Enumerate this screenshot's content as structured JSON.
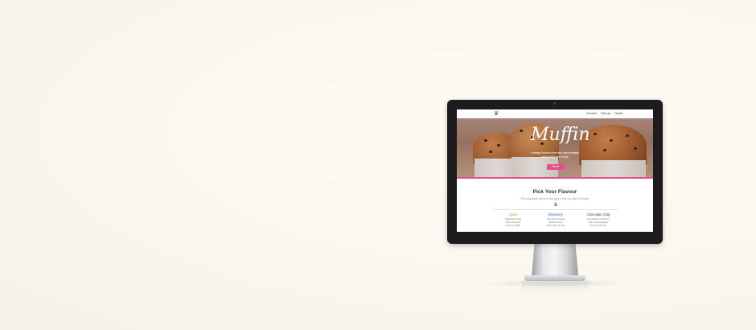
{
  "site": {
    "nav": {
      "links": [
        "Overview",
        "Flavours",
        "Details"
      ]
    },
    "hero": {
      "title": "Muffin",
      "subtitle_line1": "A design focused free and web template",
      "subtitle_line2": "using SASS and Jekyll",
      "button_label": "Demo"
    },
    "section": {
      "title": "Pick Your Flavour",
      "subtitle": "Pick a package based on the type of site you want to design."
    },
    "flavours": [
      {
        "name": "Apple",
        "color": "#8dc63f",
        "lines": [
          "Faded Encoding",
          "Pure discovery",
          "Limit the DMS"
        ]
      },
      {
        "name": "Blueberry",
        "color": "#2b6cb0",
        "lines": [
          "Something Unique",
          "Skill the story",
          "Self Image of web"
        ]
      },
      {
        "name": "Chocolate Chip",
        "color": "#444444",
        "lines": [
          "Something to Enhance",
          "Well contemplating",
          "The introduction"
        ]
      }
    ]
  },
  "icons": {
    "nav_logo": "muffin-icon",
    "section_icon": "muffin-icon",
    "brand": "apple-logo-icon"
  },
  "colors": {
    "accent": "#e4508b",
    "bezel": "#1c1c1e",
    "background": "#f9f7ee"
  }
}
